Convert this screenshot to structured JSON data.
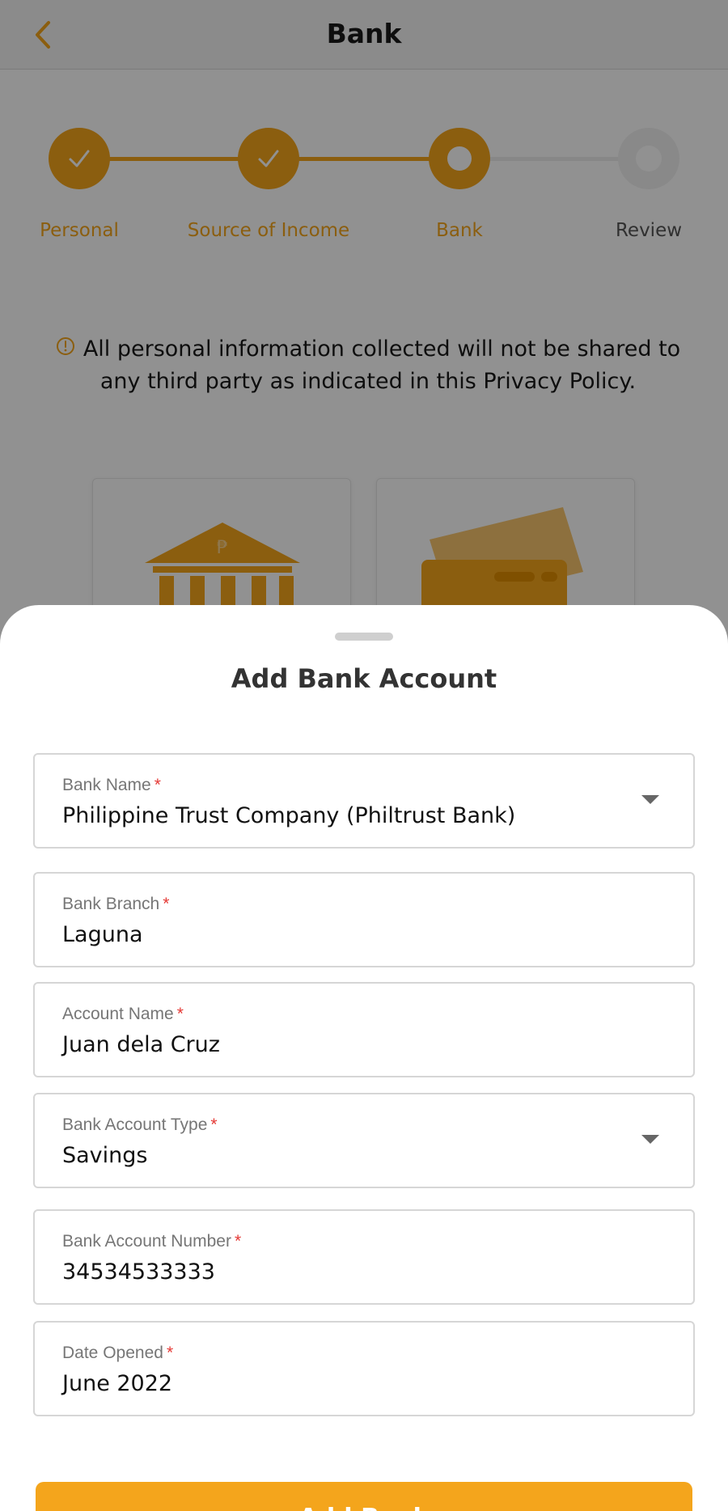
{
  "header": {
    "title": "Bank",
    "back_icon": "chevron-left-icon"
  },
  "colors": {
    "accent": "#f4a51c",
    "required": "#e53935",
    "overlay": "rgba(0,0,0,0.43)"
  },
  "stepper": {
    "steps": [
      {
        "label": "Personal",
        "state": "completed"
      },
      {
        "label": "Source of Income",
        "state": "completed"
      },
      {
        "label": "Bank",
        "state": "current"
      },
      {
        "label": "Review",
        "state": "pending"
      }
    ]
  },
  "notice": {
    "icon": "info-circle-icon",
    "text": "All personal information collected will not be shared to any third party as indicated in this Privacy Policy."
  },
  "options": [
    {
      "icon": "bank-building-icon"
    },
    {
      "icon": "credit-card-icon"
    }
  ],
  "sheet": {
    "title": "Add Bank Account",
    "fields": {
      "bank_name": {
        "label": "Bank Name",
        "value": "Philippine Trust Company (Philtrust Bank)"
      },
      "bank_branch": {
        "label": "Bank Branch",
        "value": "Laguna"
      },
      "account_name": {
        "label": "Account Name",
        "value": "Juan dela Cruz"
      },
      "account_type": {
        "label": "Bank Account Type",
        "value": "Savings"
      },
      "account_number": {
        "label": "Bank Account Number",
        "value": "34534533333"
      },
      "date_opened": {
        "label": "Date Opened",
        "value": "June 2022"
      }
    },
    "required_marker": "*",
    "submit_label": "Add Bank"
  }
}
